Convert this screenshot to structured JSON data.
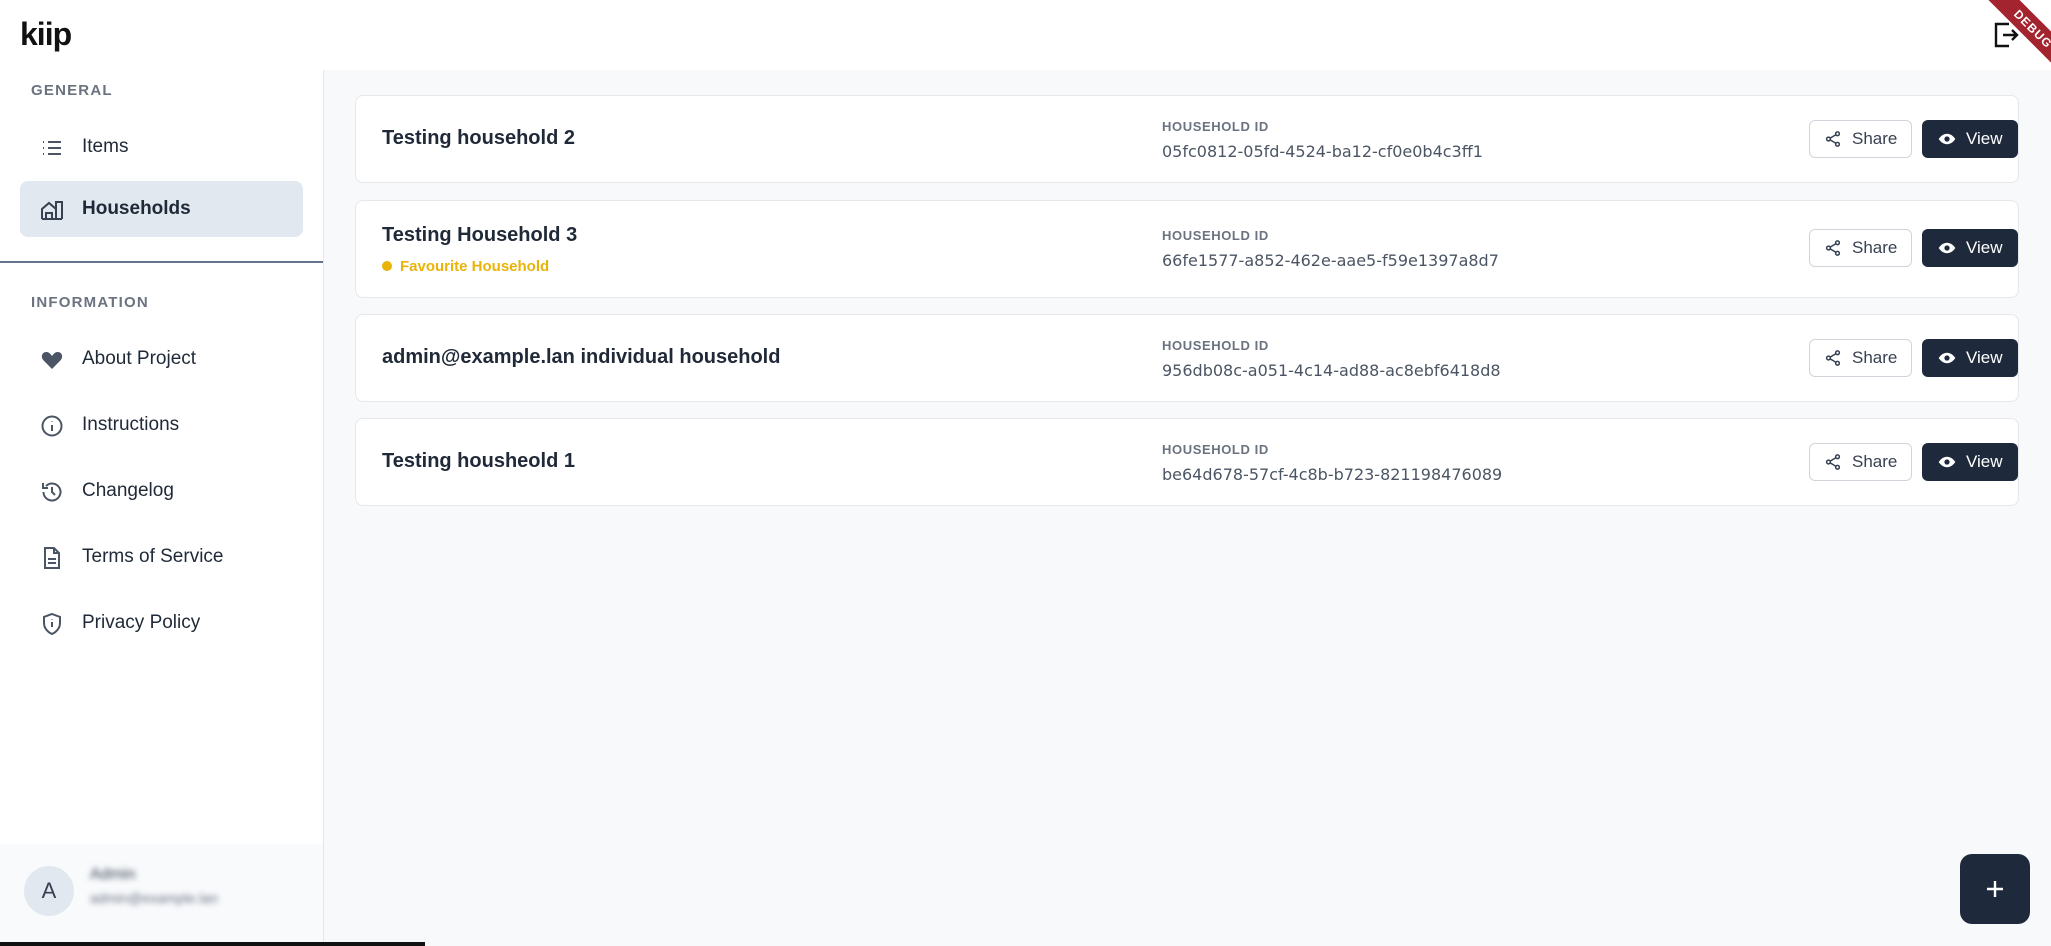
{
  "app": {
    "logo": "kiip",
    "debug_label": "DEBUG"
  },
  "sidebar": {
    "general_title": "GENERAL",
    "general_items": [
      {
        "label": "Items",
        "icon": "list-icon",
        "active": false
      },
      {
        "label": "Households",
        "icon": "household-icon",
        "active": true
      }
    ],
    "information_title": "INFORMATION",
    "information_items": [
      {
        "label": "About Project",
        "icon": "heart-icon"
      },
      {
        "label": "Instructions",
        "icon": "info-icon"
      },
      {
        "label": "Changelog",
        "icon": "history-icon"
      },
      {
        "label": "Terms of Service",
        "icon": "document-icon"
      },
      {
        "label": "Privacy Policy",
        "icon": "shield-icon"
      }
    ],
    "user": {
      "initial": "A",
      "name": "Admin",
      "email": "admin@example.lan"
    }
  },
  "households": [
    {
      "name": "Testing household 2",
      "favourite": "",
      "id_label": "HOUSEHOLD ID",
      "id": "05fc0812-05fd-4524-ba12-cf0e0b4c3ff1",
      "share": "Share",
      "view": "View"
    },
    {
      "name": "Testing Household 3",
      "favourite": "Favourite Household",
      "id_label": "HOUSEHOLD ID",
      "id": "66fe1577-a852-462e-aae5-f59e1397a8d7",
      "share": "Share",
      "view": "View"
    },
    {
      "name": "admin@example.lan individual household",
      "favourite": "",
      "id_label": "HOUSEHOLD ID",
      "id": "956db08c-a051-4c14-ad88-ac8ebf6418d8",
      "share": "Share",
      "view": "View"
    },
    {
      "name": "Testing housheold 1",
      "favourite": "",
      "id_label": "HOUSEHOLD ID",
      "id": "be64d678-57cf-4c8b-b723-821198476089",
      "share": "Share",
      "view": "View"
    }
  ],
  "colors": {
    "primary": "#1e293b",
    "favourite": "#eab308",
    "active_nav": "#e2e8f0",
    "debug": "#a3232e"
  }
}
